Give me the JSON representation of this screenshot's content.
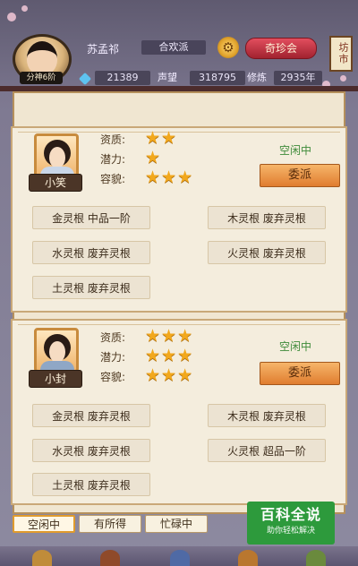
{
  "header": {
    "rank_tag": "分神6阶",
    "player_name": "苏孟祁",
    "sect": "合欢派",
    "qizhen_label": "奇珍会",
    "fangshi_label": "坊市",
    "spirit_stones": "21389",
    "reputation_label": "声望",
    "reputation_value": "318795",
    "cultivation_label": "修炼",
    "cultivation_value": "2935年"
  },
  "disciples": [
    {
      "name": "小笑",
      "attributes": [
        {
          "label": "资质:",
          "stars": 2
        },
        {
          "label": "潜力:",
          "stars": 1
        },
        {
          "label": "容貌:",
          "stars": 3
        }
      ],
      "status": "空闲中",
      "dispatch_label": "委派",
      "roots": [
        "金灵根 中品一阶",
        "木灵根 废弃灵根",
        "水灵根 废弃灵根",
        "火灵根 废弃灵根",
        "土灵根 废弃灵根"
      ]
    },
    {
      "name": "小封",
      "attributes": [
        {
          "label": "资质:",
          "stars": 3
        },
        {
          "label": "潜力:",
          "stars": 3
        },
        {
          "label": "容貌:",
          "stars": 3
        }
      ],
      "status": "空闲中",
      "dispatch_label": "委派",
      "roots": [
        "金灵根 废弃灵根",
        "木灵根 废弃灵根",
        "水灵根 废弃灵根",
        "火灵根 超品一阶",
        "土灵根 废弃灵根"
      ]
    }
  ],
  "filter_tabs": [
    "空闲中",
    "有所得",
    "忙碌中"
  ],
  "active_filter": "空闲中",
  "watermark": {
    "title": "百科全说",
    "subtitle": "助你轻松解决"
  },
  "colors": {
    "accent": "#e07d2f",
    "status_green": "#3e8b3a",
    "star": "#f2a81d"
  }
}
